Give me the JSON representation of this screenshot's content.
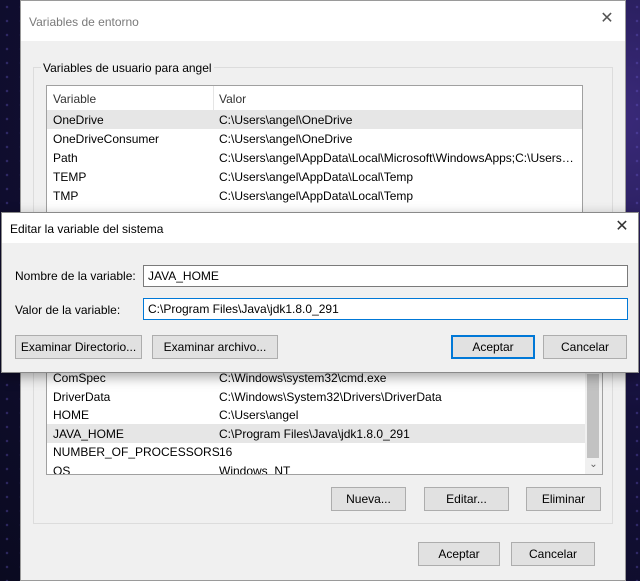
{
  "main_dialog": {
    "title": "Variables de entorno",
    "user_group_label": "Variables de usuario para angel",
    "columns": [
      "Variable",
      "Valor"
    ],
    "user_vars": [
      {
        "name": "OneDrive",
        "value": "C:\\Users\\angel\\OneDrive",
        "selected": true
      },
      {
        "name": "OneDriveConsumer",
        "value": "C:\\Users\\angel\\OneDrive",
        "selected": false
      },
      {
        "name": "Path",
        "value": "C:\\Users\\angel\\AppData\\Local\\Microsoft\\WindowsApps;C:\\Users\\a...",
        "selected": false
      },
      {
        "name": "TEMP",
        "value": "C:\\Users\\angel\\AppData\\Local\\Temp",
        "selected": false
      },
      {
        "name": "TMP",
        "value": "C:\\Users\\angel\\AppData\\Local\\Temp",
        "selected": false
      }
    ],
    "system_vars": [
      {
        "name": "ComSpec",
        "value": "C:\\Windows\\system32\\cmd.exe",
        "selected": false
      },
      {
        "name": "DriverData",
        "value": "C:\\Windows\\System32\\Drivers\\DriverData",
        "selected": false
      },
      {
        "name": "HOME",
        "value": "C:\\Users\\angel",
        "selected": false
      },
      {
        "name": "JAVA_HOME",
        "value": "C:\\Program Files\\Java\\jdk1.8.0_291",
        "selected": true
      },
      {
        "name": "NUMBER_OF_PROCESSORS",
        "value": "16",
        "selected": false
      },
      {
        "name": "OS",
        "value": "Windows_NT",
        "selected": false
      }
    ],
    "system_buttons": {
      "new": "Nueva...",
      "edit": "Editar...",
      "delete": "Eliminar"
    },
    "footer_buttons": {
      "ok": "Aceptar",
      "cancel": "Cancelar"
    }
  },
  "edit_dialog": {
    "title": "Editar la variable del sistema",
    "name_label": "Nombre de la variable:",
    "name_value": "JAVA_HOME",
    "value_label": "Valor de la variable:",
    "value_value": "C:\\Program Files\\Java\\jdk1.8.0_291",
    "browse_dir": "Examinar Directorio...",
    "browse_file": "Examinar archivo...",
    "ok": "Aceptar",
    "cancel": "Cancelar"
  },
  "icons": {
    "close": "close-icon",
    "scroll_up": "chevron-up-icon",
    "scroll_down": "chevron-down-icon"
  }
}
